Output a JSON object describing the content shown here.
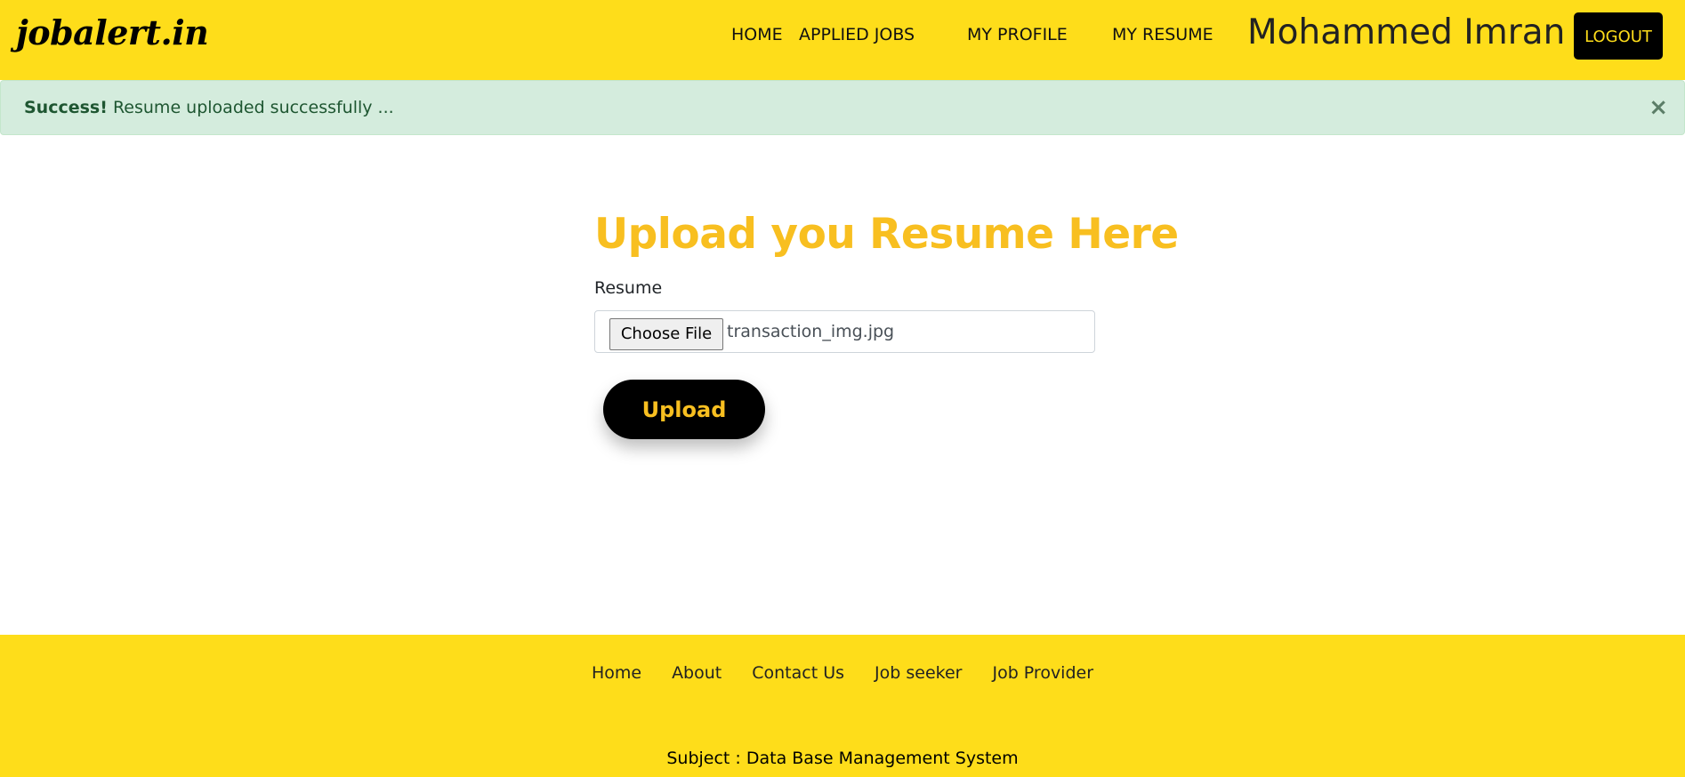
{
  "header": {
    "brand": "jobalert.in",
    "nav": {
      "home": "HOME",
      "applied_jobs": "APPLIED JOBS",
      "my_profile": "MY PROFILE",
      "my_resume": "MY RESUME"
    },
    "user_name": "Mohammed Imran",
    "logout_label": "LOGOUT"
  },
  "alert": {
    "strong": "Success!",
    "message": "Resume uploaded successfully ...",
    "close_glyph": "×"
  },
  "form": {
    "title": "Upload you Resume Here",
    "resume_label": "Resume",
    "choose_file_label": "Choose File",
    "selected_file": "transaction_img.jpg",
    "upload_label": "Upload"
  },
  "footer": {
    "links": [
      "Home",
      "About",
      "Contact Us",
      "Job seeker",
      "Job Provider"
    ],
    "subject": "Subject : Data Base Management System"
  },
  "colors": {
    "header_bg": "#fedd1a",
    "accent_text": "#f8bf20",
    "alert_bg": "#d4ecdd",
    "alert_text": "#1e5631",
    "button_bg": "#000000"
  }
}
